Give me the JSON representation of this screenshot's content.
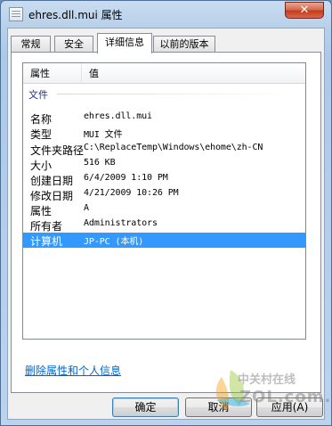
{
  "window": {
    "title": "ehres.dll.mui 属性",
    "close_glyph": "✕"
  },
  "tabs": [
    {
      "label": "常规",
      "active": false
    },
    {
      "label": "安全",
      "active": false
    },
    {
      "label": "详细信息",
      "active": true
    },
    {
      "label": "以前的版本",
      "active": false
    }
  ],
  "details": {
    "columns": {
      "property": "属性",
      "value": "值"
    },
    "group": "文件",
    "rows": [
      {
        "key": "名称",
        "value": "ehres.dll.mui"
      },
      {
        "key": "类型",
        "value": "MUI 文件"
      },
      {
        "key": "文件夹路径",
        "value": "C:\\ReplaceTemp\\Windows\\ehome\\zh-CN"
      },
      {
        "key": "大小",
        "value": "516 KB"
      },
      {
        "key": "创建日期",
        "value": "6/4/2009 1:10 PM"
      },
      {
        "key": "修改日期",
        "value": "4/21/2009 10:26 PM"
      },
      {
        "key": "属性",
        "value": "A"
      },
      {
        "key": "所有者",
        "value": "Administrators"
      },
      {
        "key": "计算机",
        "value": "JP-PC (本机)",
        "selected": true
      }
    ]
  },
  "links": {
    "remove_properties": "删除属性和个人信息"
  },
  "buttons": {
    "ok": "确定",
    "cancel": "取消",
    "apply": "应用(A)"
  },
  "watermark": {
    "line1": "中关村在线",
    "line2": "ZOL.com.cn"
  },
  "colors": {
    "selection": "#3399ff",
    "link": "#0066cc",
    "group_label": "#1e3287",
    "close": "#c4381b"
  }
}
